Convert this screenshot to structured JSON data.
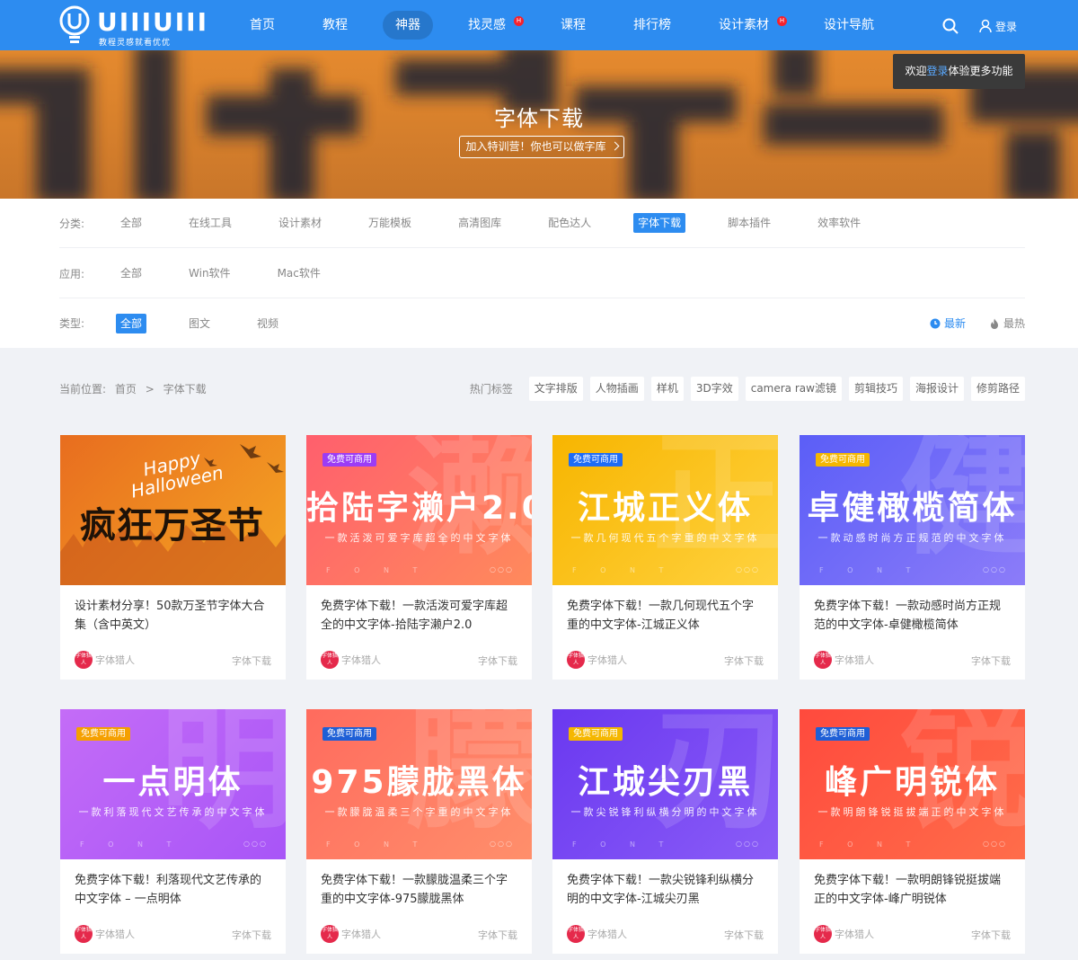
{
  "header": {
    "logo_text": "UIIIUIII",
    "logo_slogan": "教程灵感就看优优",
    "nav": [
      {
        "label": "首页",
        "active": false,
        "badge": ""
      },
      {
        "label": "教程",
        "active": false,
        "badge": ""
      },
      {
        "label": "神器",
        "active": true,
        "badge": ""
      },
      {
        "label": "找灵感",
        "active": false,
        "badge": "H"
      },
      {
        "label": "课程",
        "active": false,
        "badge": ""
      },
      {
        "label": "排行榜",
        "active": false,
        "badge": ""
      },
      {
        "label": "设计素材",
        "active": false,
        "badge": "H"
      },
      {
        "label": "设计导航",
        "active": false,
        "badge": ""
      }
    ],
    "login_label": "登录",
    "accent_color": "#2d8cf0"
  },
  "banner": {
    "title": "字体下载",
    "button_label": "加入特训营！你也可以做字库"
  },
  "welcome": {
    "prefix": "欢迎",
    "link": "登录",
    "suffix": "体验更多功能"
  },
  "filters": {
    "category": {
      "label": "分类:",
      "items": [
        "全部",
        "在线工具",
        "设计素材",
        "万能模板",
        "高清图库",
        "配色达人",
        "字体下载",
        "脚本插件",
        "效率软件"
      ],
      "active_index": 6
    },
    "app": {
      "label": "应用:",
      "items": [
        "全部",
        "Win软件",
        "Mac软件"
      ],
      "active_index": -1
    },
    "type": {
      "label": "类型:",
      "items": [
        "全部",
        "图文",
        "视频"
      ],
      "active_index": 0
    },
    "sort": [
      {
        "label": "最新",
        "icon": "clock-icon",
        "active": true
      },
      {
        "label": "最热",
        "icon": "fire-icon",
        "active": false
      }
    ]
  },
  "breadcrumb": {
    "label": "当前位置:",
    "home": "首页",
    "sep": ">",
    "current": "字体下载"
  },
  "hot_tags": {
    "label": "热门标签",
    "items": [
      "文字排版",
      "人物插画",
      "样机",
      "3D字效",
      "camera raw滤镜",
      "剪辑技巧",
      "海报设计",
      "修剪路径"
    ]
  },
  "cards": [
    {
      "badge": "",
      "badge_color": "",
      "name": "",
      "bg_char": "",
      "subtitle": "",
      "font_word": "",
      "dots": "",
      "title": "设计素材分享！50款万圣节字体大合集（含中英文）",
      "author": "字体猎人",
      "avatar_text": "字体猎人",
      "category": "字体下载",
      "gradient": [
        "#e86d1f",
        "#f5a623"
      ],
      "halloween": {
        "line1": "Happy",
        "line2": "Halloween",
        "main": "疯狂万圣节"
      }
    },
    {
      "badge": "免费可商用",
      "badge_color": "#9b3cf6",
      "name": "拾陆字濑户2.0",
      "bg_char": "濑",
      "subtitle": "一款活泼可爱字库超全的中文字体",
      "font_word": "F O N T",
      "dots": "○○○",
      "title": "免费字体下载！一款活泼可爱字库超全的中文字体-拾陆字濑户2.0",
      "author": "字体猎人",
      "avatar_text": "字体猎人",
      "category": "字体下载",
      "gradient": [
        "#ff5f6d",
        "#ff8a5c"
      ]
    },
    {
      "badge": "免费可商用",
      "badge_color": "#1e6cf5",
      "name": "江城正义体",
      "bg_char": "正",
      "subtitle": "一款几何现代五个字重的中文字体",
      "font_word": "F O N T",
      "dots": "○○○",
      "title": "免费字体下载！一款几何现代五个字重的中文字体-江城正义体",
      "author": "字体猎人",
      "avatar_text": "字体猎人",
      "category": "字体下载",
      "gradient": [
        "#f7b500",
        "#ffd23f"
      ]
    },
    {
      "badge": "免费可商用",
      "badge_color": "#f5b700",
      "name": "卓健橄榄简体",
      "bg_char": "健",
      "subtitle": "一款动感时尚方正规范的中文字体",
      "font_word": "F O N T",
      "dots": "○○○",
      "title": "免费字体下载！一款动感时尚方正规范的中文字体-卓健橄榄简体",
      "author": "字体猎人",
      "avatar_text": "字体猎人",
      "category": "字体下载",
      "gradient": [
        "#5b5ef7",
        "#8c7cf9"
      ]
    },
    {
      "badge": "免费可商用",
      "badge_color": "#f5a000",
      "name": "一点明体",
      "bg_char": "明",
      "subtitle": "一款利落现代文艺传承的中文字体",
      "font_word": "F O N T",
      "dots": "○○○",
      "title": "免费字体下载！利落现代文艺传承的中文字体 – 一点明体",
      "author": "字体猎人",
      "avatar_text": "字体猎人",
      "category": "字体下载",
      "gradient": [
        "#c46cf7",
        "#a855f7"
      ]
    },
    {
      "badge": "免费可商用",
      "badge_color": "#1e5fd6",
      "name": "975朦胧黑体",
      "bg_char": "朦",
      "subtitle": "一款朦胧温柔三个字重的中文字体",
      "font_word": "F O N T",
      "dots": "○○○",
      "title": "免费字体下载！一款朦胧温柔三个字重的中文字体-975朦胧黑体",
      "author": "字体猎人",
      "avatar_text": "字体猎人",
      "category": "字体下载",
      "gradient": [
        "#ff6b5e",
        "#ff8f6b"
      ]
    },
    {
      "badge": "免费可商用",
      "badge_color": "#f5b700",
      "name": "江城尖刃黑",
      "bg_char": "刃",
      "subtitle": "一款尖锐锋利纵横分明的中文字体",
      "font_word": "F O N T",
      "dots": "○○○",
      "title": "免费字体下载！一款尖锐锋利纵横分明的中文字体-江城尖刃黑",
      "author": "字体猎人",
      "avatar_text": "字体猎人",
      "category": "字体下载",
      "gradient": [
        "#6a38f0",
        "#8a5cf7"
      ]
    },
    {
      "badge": "免费可商用",
      "badge_color": "#1e5fd6",
      "name": "峰广明锐体",
      "bg_char": "锐",
      "subtitle": "一款明朗锋锐挺拔端正的中文字体",
      "font_word": "F O N T",
      "dots": "○○○",
      "title": "免费字体下载！一款明朗锋锐挺拔端正的中文字体-峰广明锐体",
      "author": "字体猎人",
      "avatar_text": "字体猎人",
      "category": "字体下载",
      "gradient": [
        "#ff4a3d",
        "#ff6d4a"
      ]
    }
  ]
}
